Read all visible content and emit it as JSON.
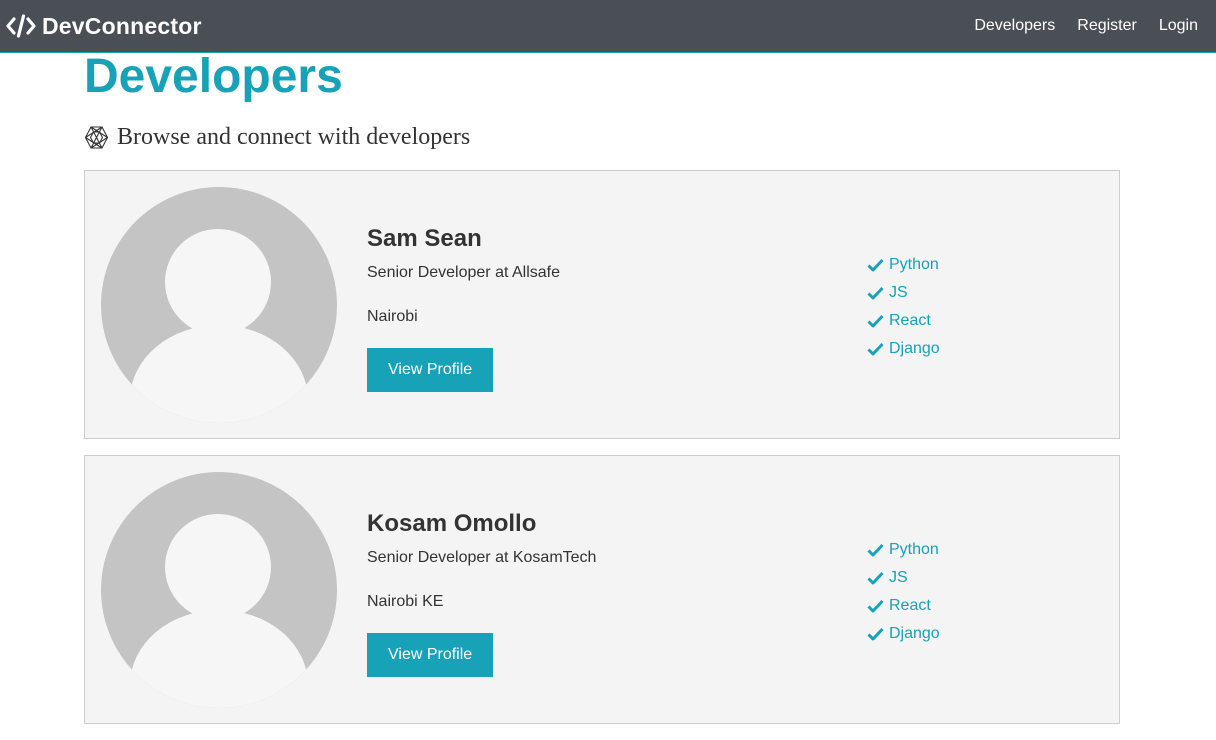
{
  "navbar": {
    "brand": "DevConnector",
    "brand_icon": "code-icon",
    "links": [
      {
        "label": "Developers"
      },
      {
        "label": "Register"
      },
      {
        "label": "Login"
      }
    ]
  },
  "page": {
    "title": "Developers",
    "lead": "Browse and connect with developers",
    "lead_icon": "connectdevelop-icon"
  },
  "profiles": [
    {
      "name": "Sam Sean",
      "role": "Senior Developer at Allsafe",
      "location": "Nairobi",
      "button": "View Profile",
      "skills": [
        "Python",
        "JS",
        "React",
        "Django"
      ]
    },
    {
      "name": "Kosam Omollo",
      "role": "Senior Developer at KosamTech",
      "location": "Nairobi KE",
      "button": "View Profile",
      "skills": [
        "Python",
        "JS",
        "React",
        "Django"
      ]
    }
  ],
  "colors": {
    "primary": "#17a2b8",
    "navbar": "#4a4e55",
    "card_bg": "#f4f4f4",
    "avatar_bg": "#c4c4c4"
  }
}
